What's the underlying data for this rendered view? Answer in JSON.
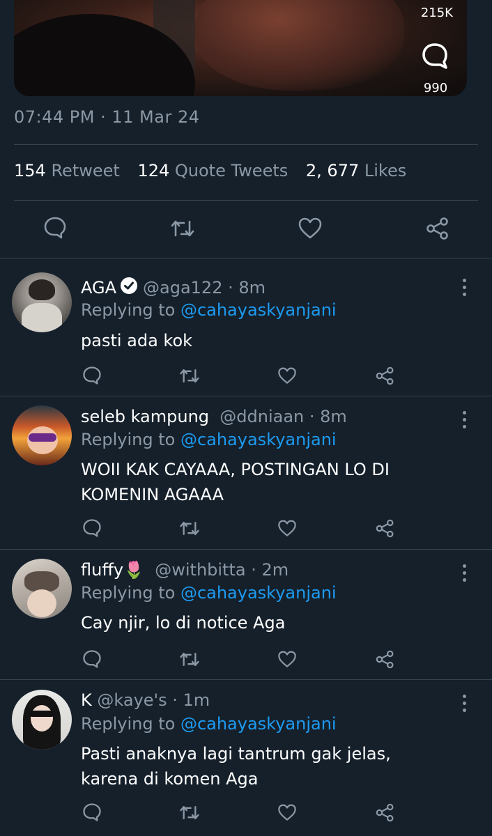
{
  "media": {
    "views": "215K",
    "comments": "990"
  },
  "tweet": {
    "timestamp": "07:44 PM · 11 Mar 24",
    "retweets_count": "154",
    "retweets_label": "Retweet",
    "quotes_count": "124",
    "quotes_label": "Quote Tweets",
    "likes_count": "2, 677",
    "likes_label": "Likes"
  },
  "replies": [
    {
      "name": "AGA",
      "verified": true,
      "handle": "@aga122 · 8m",
      "replying_prefix": "Replying to ",
      "replying_to": "@cahayaskyanjani",
      "text": "pasti ada kok"
    },
    {
      "name": "seleb kampung",
      "verified": false,
      "handle": "@ddniaan · 8m",
      "replying_prefix": "Replying to ",
      "replying_to": "@cahayaskyanjani",
      "text": "WOII KAK CAYAAA,  POSTINGAN LO DI KOMENIN AGAAA"
    },
    {
      "name": "fluffy",
      "name_emoji": "🌷",
      "verified": false,
      "handle": "@withbitta · 2m",
      "replying_prefix": "Replying to ",
      "replying_to": "@cahayaskyanjani",
      "text": "Cay njir,  lo di notice Aga"
    },
    {
      "name": "K",
      "verified": false,
      "handle": "@kaye's · 1m",
      "replying_prefix": "Replying to ",
      "replying_to": "@cahayaskyanjani",
      "text": "Pasti anaknya lagi tantrum gak jelas, karena di komen Aga"
    }
  ],
  "colors": {
    "background": "#15202b",
    "muted": "#8b98a5",
    "link": "#1d9bf0",
    "divider": "#38444d"
  },
  "icons": [
    "comment-icon",
    "retweet-icon",
    "heart-icon",
    "share-icon",
    "more-icon",
    "verified-icon"
  ]
}
